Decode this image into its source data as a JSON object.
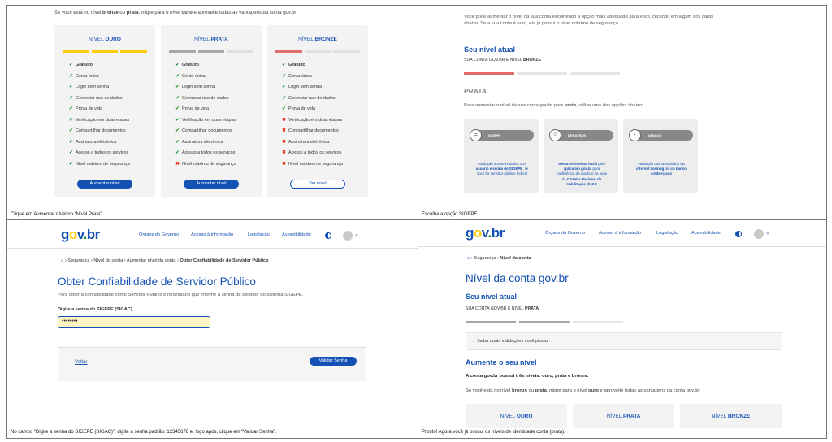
{
  "panel1": {
    "intro_a": "Se você está no nível ",
    "intro_b": "bronze",
    "intro_c": " ou ",
    "intro_d": "prata",
    "intro_e": ", migre para o nível ",
    "intro_f": "ouro",
    "intro_g": " e aproveite todas as vantagens da conta gov.br!",
    "cards": [
      {
        "title_a": "NÍVEL ",
        "title_b": "OURO",
        "button": "Aumentar nível"
      },
      {
        "title_a": "NÍVEL ",
        "title_b": "PRATA",
        "button": "Aumentar nível"
      },
      {
        "title_a": "NÍVEL ",
        "title_b": "BRONZE",
        "button": "Ver nível"
      }
    ],
    "features": [
      "Gratuito",
      "Conta única",
      "Login sem senha",
      "Gerenciar uso de dados",
      "Prova de vida",
      "Verificação em duas etapas",
      "Compartilhar documentos",
      "Assinatura eletrônica",
      "Acesso a todos os serviços",
      "Nível máximo de segurança"
    ],
    "caption": "Clique em Aumentar nível no “Nível Prata”"
  },
  "panel2": {
    "intro_line1": "Você pode aumentar o nível da sua conta escolhendo a opção mais adequada para você, clicando em algum dos cards",
    "intro_line2": "abaixo. Se a sua conta é ouro, ela já possui o nível máximo de segurança.",
    "level_title": "Seu nível atual",
    "level_sub_a": "SUA CONTA GOV.BR É NÍVEL ",
    "level_sub_b": "BRONZE",
    "section_title": "PRATA",
    "section_text_a": "Para aumentar o nível da sua conta gov.br para ",
    "section_text_b": "prata",
    "section_text_c": ", utilize uma das opções abaixo:",
    "options": [
      {
        "label": "SIGEPE",
        "d1": "Validação dos seus dados com",
        "d2": "usuário e senha do SIGEPE",
        "d3": ", se",
        "d4": "você for servidor público federal"
      },
      {
        "label": "DENATRAN",
        "d1": "Reconhecimento facial",
        "d2": " pelo",
        "d3": "aplicativo gov.br",
        "d4": " para",
        "d5": "conferência da sua foto na base",
        "d6": "da ",
        "d7": "Carteira Nacional de",
        "d8": "Habilitação (CNH)"
      },
      {
        "label": "BANCOS",
        "d1": "Validação dos seus dados via",
        "d2": "internet banking",
        "d3": " de um ",
        "d4": "banco",
        "d5": "credenciado"
      }
    ],
    "caption": "Escolha a opção SIGEPE"
  },
  "header": {
    "logo_a": "g",
    "logo_o": "o",
    "logo_b": "v",
    "logo_dot": ".",
    "logo_c": "br",
    "links": [
      "Órgaos do Governo",
      "Acesso à informação",
      "Legislação",
      "Acessibilidade"
    ]
  },
  "panel3": {
    "crumbs": [
      "Segurança",
      "Nível da conta",
      "Aumentar nível da conta",
      "Obter Confiabilidade de Servidor Público"
    ],
    "title": "Obter Confiabilidade de Servidor Público",
    "text": "Para obter a confiabilidade como Servidor Público é necessário que informe a senha de servidor do sistema SIGEPE.",
    "field_label": "Digite a senha do SIGEPE (SIGAC)",
    "field_value": "••••••••",
    "back": "Voltar",
    "validate": "Validar Senha",
    "caption": "No campo “Digite a senha do SIGEPE (SIGAC)”, digite a senha padrão: 12345678 e, logo após, clique em “Validar Senha”."
  },
  "panel4": {
    "crumbs": [
      "Segurança",
      "Nível da conta"
    ],
    "title": "Nível da conta gov.br",
    "level_title": "Seu nível atual",
    "level_sub_a": "SUA CONTA GOV.BR É NÍVEL ",
    "level_sub_b": "PRATA",
    "accordion": "Saiba quais validações você possui",
    "raise_title": "Aumente o seu nível",
    "bold_line": "A conta gov.br possui três níveis: ouro, prata e bronze.",
    "text_a": "Se você está no nível ",
    "text_b": "bronze",
    "text_c": " ou ",
    "text_d": "prata",
    "text_e": ", migre para o nível ",
    "text_f": "ouro",
    "text_g": " e aproveite todas as vantagens da conta gov.br!",
    "mini_cards": [
      {
        "a": "NÍVEL ",
        "b": "OURO"
      },
      {
        "a": "NÍVEL ",
        "b": "PRATA"
      },
      {
        "a": "NÍVEL ",
        "b": "BRONZE"
      }
    ],
    "caption": "Pronto! Agora você já possui os níveis de identidade conta  (prata)."
  },
  "colors": {
    "primary": "#1351b4",
    "gold": "#ffcd07",
    "silver": "#a8a8a8",
    "bronze": "#e36c6c",
    "ok": "#168821",
    "no": "#e52207"
  }
}
